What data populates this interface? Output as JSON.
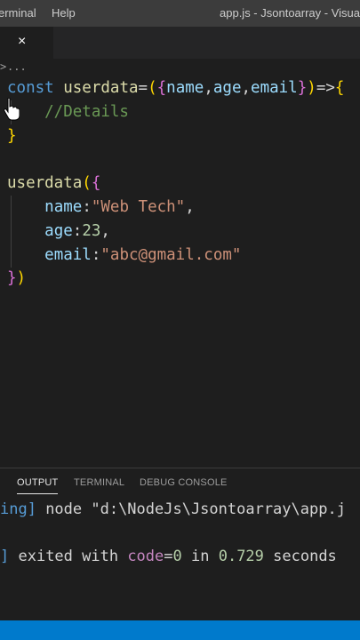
{
  "titlebar": {
    "menu": [
      "erminal",
      "Help"
    ],
    "window_title": "app.js - Jsontoarray - Visua"
  },
  "tab": {
    "close_glyph": "×"
  },
  "breadcrumb": {
    "chevron": ">",
    "ellipsis": "..."
  },
  "editor": {
    "code_lines": [
      "const userdata=({name,age,email})=>{",
      "    //Details",
      "}",
      "",
      "userdata({",
      "    name:\"Web Tech\",",
      "    age:23,",
      "    email:\"abc@gmail.com\"",
      "})"
    ]
  },
  "panel": {
    "tabs": [
      "OUTPUT",
      "TERMINAL",
      "DEBUG CONSOLE"
    ],
    "active_tab": "OUTPUT",
    "lines": [
      {
        "prefix": "ing]",
        "text": " node \"d:\\NodeJs\\Jsontoarray\\app.j"
      },
      {
        "prefix": "]",
        "mid": " exited with ",
        "key": "code",
        "eq": "=",
        "code": "0",
        "mid2": " in ",
        "secs": "0.729",
        "tail": " seconds"
      }
    ]
  },
  "colors": {
    "keyword": "#569cd6",
    "function": "#dcdcaa",
    "string": "#ce9178",
    "number": "#b5cea8",
    "property": "#9cdcfe",
    "comment": "#6a9955",
    "statusbar": "#007acc"
  }
}
